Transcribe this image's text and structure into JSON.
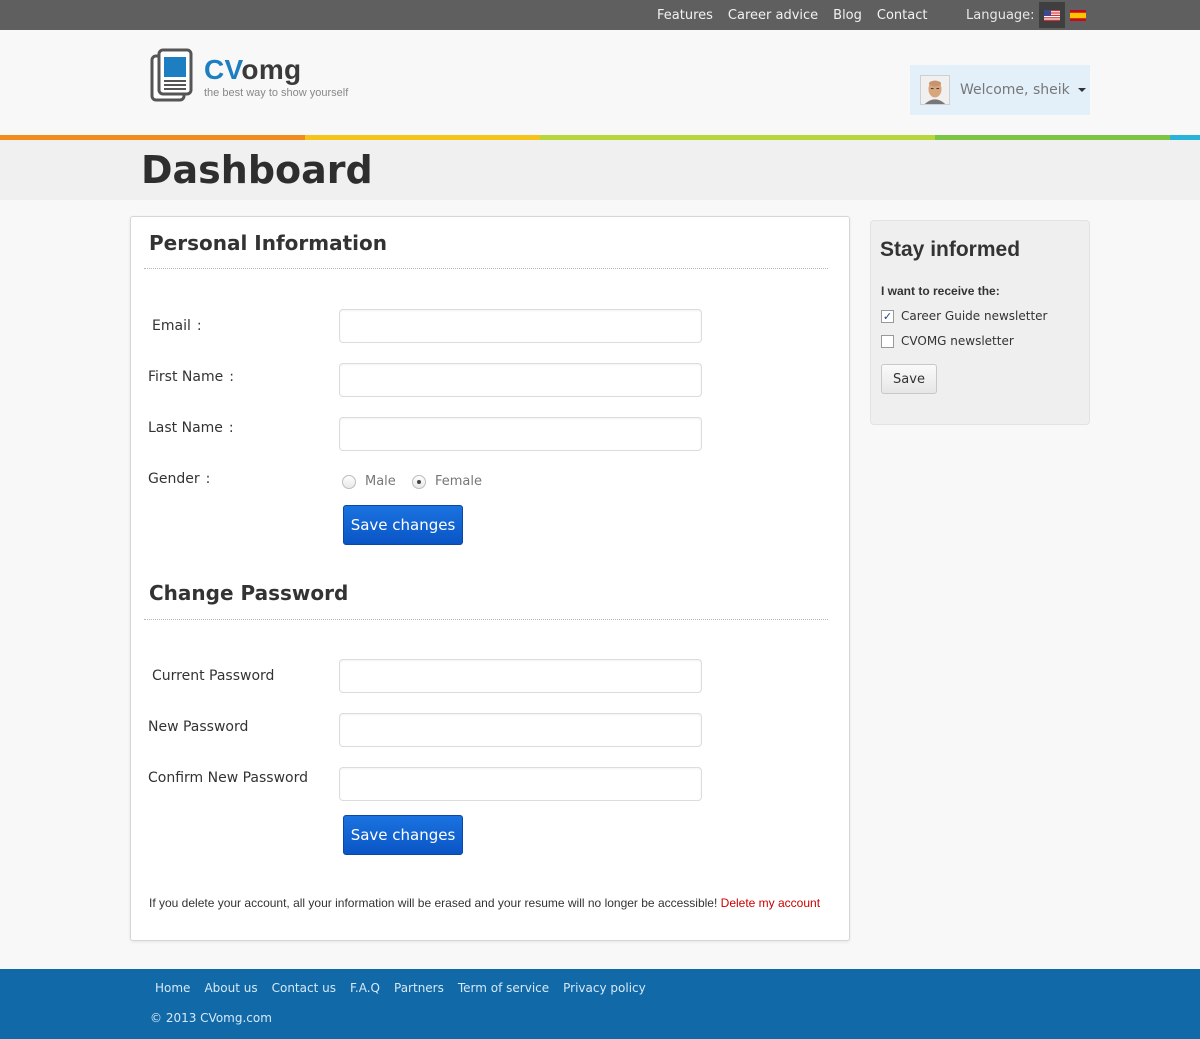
{
  "topbar": {
    "nav": [
      "Features",
      "Career advice",
      "Blog",
      "Contact"
    ],
    "language_label": "Language:",
    "languages": [
      {
        "name": "english-flag",
        "active": true
      },
      {
        "name": "spanish-flag",
        "active": false
      }
    ]
  },
  "header": {
    "logo_cv": "CV",
    "logo_omg": "omg",
    "tagline": "the best way to show yourself",
    "welcome": "Welcome, sheik"
  },
  "page": {
    "title": "Dashboard"
  },
  "personal": {
    "title": "Personal Information",
    "email_label": "Email",
    "first_name_label": "First Name",
    "last_name_label": "Last Name",
    "gender_label": "Gender",
    "colon": ":",
    "gender_options": [
      "Male",
      "Female"
    ],
    "gender_selected": "Female",
    "email_value": "",
    "first_name_value": "",
    "last_name_value": "",
    "save_label": "Save changes"
  },
  "password": {
    "title": "Change Password",
    "current_label": "Current Password",
    "new_label": "New Password",
    "confirm_label": "Confirm New Password",
    "save_label": "Save changes"
  },
  "delete": {
    "note": "If you delete your account, all your information will be erased and your resume will no longer be accessible!",
    "link": "Delete my account"
  },
  "sidebar": {
    "title": "Stay informed",
    "subtitle": "I want to receive the:",
    "options": [
      {
        "label": "Career Guide newsletter",
        "checked": true
      },
      {
        "label": "CVOMG newsletter",
        "checked": false
      }
    ],
    "save_label": "Save"
  },
  "footer": {
    "nav": [
      "Home",
      "About us",
      "Contact us",
      "F.A.Q",
      "Partners",
      "Term of service",
      "Privacy policy"
    ],
    "copyright": "© 2013 CVomg.com"
  },
  "colors": {
    "topbar": "#5f5f5f",
    "brand_blue": "#1d7ec2",
    "primary_button": "#1a73e0",
    "footer": "#1169a8",
    "stripe": [
      "#f28b1c",
      "#f6c31a",
      "#b6d63a",
      "#7cc443",
      "#2ab3d9"
    ]
  }
}
